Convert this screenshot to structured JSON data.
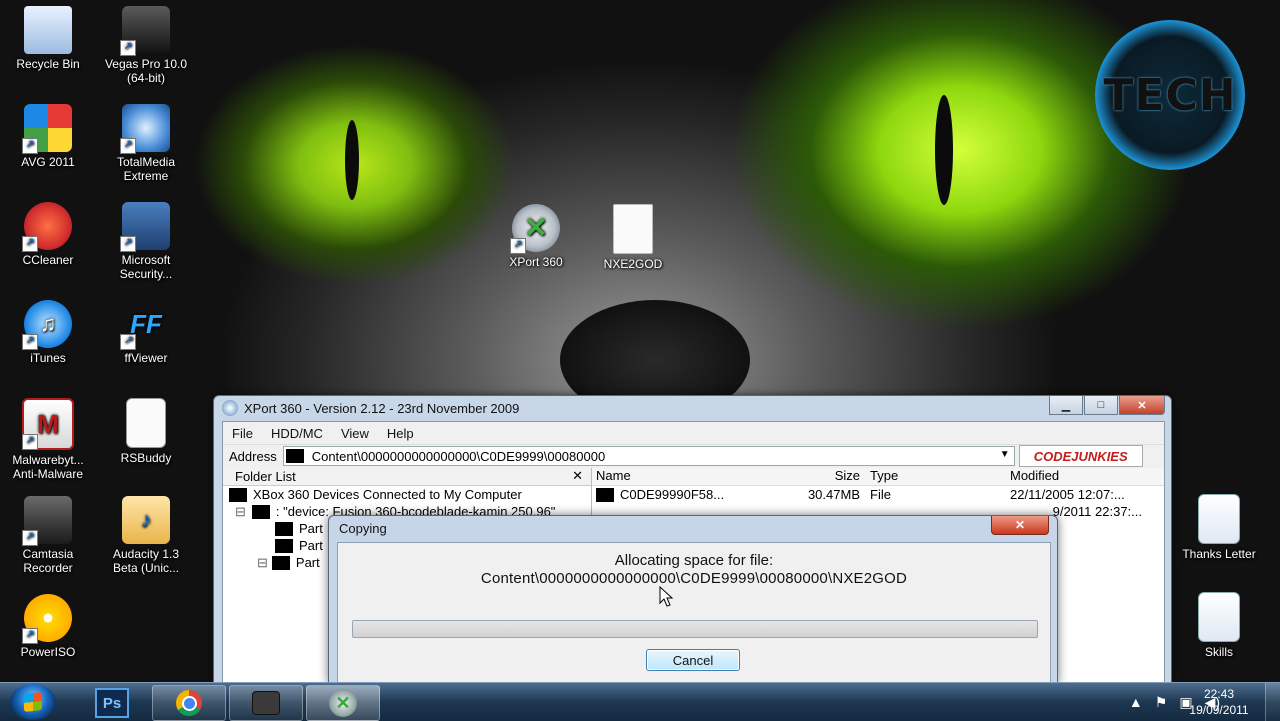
{
  "desktop": {
    "icons": [
      {
        "label": "Recycle Bin"
      },
      {
        "label": "Vegas Pro 10.0 (64-bit)"
      },
      {
        "label": "AVG 2011"
      },
      {
        "label": "TotalMedia Extreme"
      },
      {
        "label": "CCleaner"
      },
      {
        "label": "Microsoft Security..."
      },
      {
        "label": "iTunes"
      },
      {
        "label": "ffViewer"
      },
      {
        "label": "Malwarebyt... Anti-Malware"
      },
      {
        "label": "RSBuddy"
      },
      {
        "label": "Camtasia Recorder"
      },
      {
        "label": "Audacity 1.3 Beta (Unic..."
      },
      {
        "label": "PowerISO"
      },
      {
        "label": "XPort 360"
      },
      {
        "label": "NXE2GOD"
      },
      {
        "label": "Thanks Letter"
      },
      {
        "label": "Skills"
      }
    ],
    "logo_text": "TECH",
    "icon_glyphs": {
      "ff": "FF",
      "malware": "M",
      "audacity": "♪"
    }
  },
  "xport": {
    "title": "XPort 360 - Version 2.12 - 23rd November 2009",
    "menu": [
      "File",
      "HDD/MC",
      "View",
      "Help"
    ],
    "address_label": "Address",
    "address_value": "Content\\0000000000000000\\C0DE9999\\00080000",
    "brand": "CODEJUNKIES",
    "folder_list_header": "Folder List",
    "tree": [
      {
        "text": "XBox 360 Devices Connected to My Computer"
      },
      {
        "text": ": \"device: Fusion 360-bcodeblade-kamin 250.96\""
      },
      {
        "text": "Part"
      },
      {
        "text": "Part"
      },
      {
        "text": "Part"
      }
    ],
    "columns": {
      "name": "Name",
      "size": "Size",
      "type": "Type",
      "modified": "Modified"
    },
    "rows": [
      {
        "name": "C0DE99990F58...",
        "size": "30.47MB",
        "type": "File",
        "modified": "22/11/2005 12:07:..."
      },
      {
        "name": "",
        "size": "",
        "type": "",
        "modified": "9/2011 22:37:..."
      }
    ]
  },
  "copy_dialog": {
    "title": "Copying",
    "line1": "Allocating space for file:",
    "line2": "Content\\0000000000000000\\C0DE9999\\00080000\\NXE2GOD",
    "progress_fraction": 0,
    "cancel_label": "Cancel"
  },
  "taskbar": {
    "ps_label": "Ps",
    "time": "22:43",
    "date": "19/09/2011"
  },
  "colors": {
    "progress_fill": "#4fc24f",
    "title_close": "#c8381e",
    "taskbar": "#1e3852"
  }
}
